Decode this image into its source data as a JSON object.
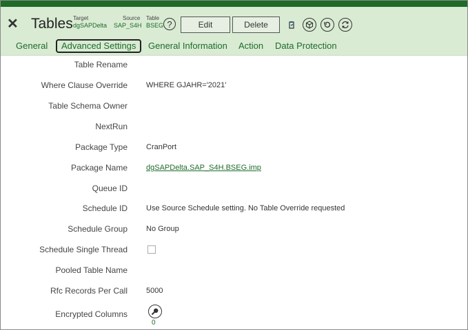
{
  "header": {
    "title": "Tables",
    "target_label": "Target",
    "target_value": "dgSAPDelta",
    "source_label": "Source",
    "source_value": "SAP_S4H",
    "table_label": "Table",
    "table_value": "BSEG",
    "help_glyph": "?",
    "edit_label": "Edit",
    "delete_label": "Delete",
    "close_glyph": "✕"
  },
  "tabs": [
    {
      "label": "General",
      "active": false
    },
    {
      "label": "Advanced Settings",
      "active": true
    },
    {
      "label": "General Information",
      "active": false
    },
    {
      "label": "Action",
      "active": false
    },
    {
      "label": "Data Protection",
      "active": false
    }
  ],
  "fields": {
    "table_rename": {
      "label": "Table Rename",
      "value": ""
    },
    "where_clause": {
      "label": "Where Clause Override",
      "value": "WHERE GJAHR='2021'"
    },
    "schema_owner": {
      "label": "Table Schema Owner",
      "value": ""
    },
    "next_run": {
      "label": "NextRun",
      "value": ""
    },
    "package_type": {
      "label": "Package Type",
      "value": "CranPort"
    },
    "package_name": {
      "label": "Package Name",
      "value": "dgSAPDelta.SAP_S4H.BSEG.imp"
    },
    "queue_id": {
      "label": "Queue ID",
      "value": ""
    },
    "schedule_id": {
      "label": "Schedule ID",
      "value": "Use Source Schedule setting.  No Table Override requested"
    },
    "schedule_group": {
      "label": "Schedule Group",
      "value": "No Group"
    },
    "schedule_single_thread": {
      "label": "Schedule Single Thread",
      "checked": false
    },
    "pooled_table_name": {
      "label": "Pooled Table Name",
      "value": ""
    },
    "rfc_records": {
      "label": "Rfc Records Per Call",
      "value": "5000"
    },
    "encrypted_columns": {
      "label": "Encrypted Columns",
      "count": "0"
    }
  },
  "colors": {
    "brand_dark": "#1e6b2a",
    "header_bg": "#d9ebd3",
    "link": "#1e6b2a"
  },
  "icons": [
    "close-icon",
    "help-icon",
    "clipboard-icon",
    "cube-icon",
    "history-icon",
    "refresh-icon",
    "search-icon"
  ]
}
